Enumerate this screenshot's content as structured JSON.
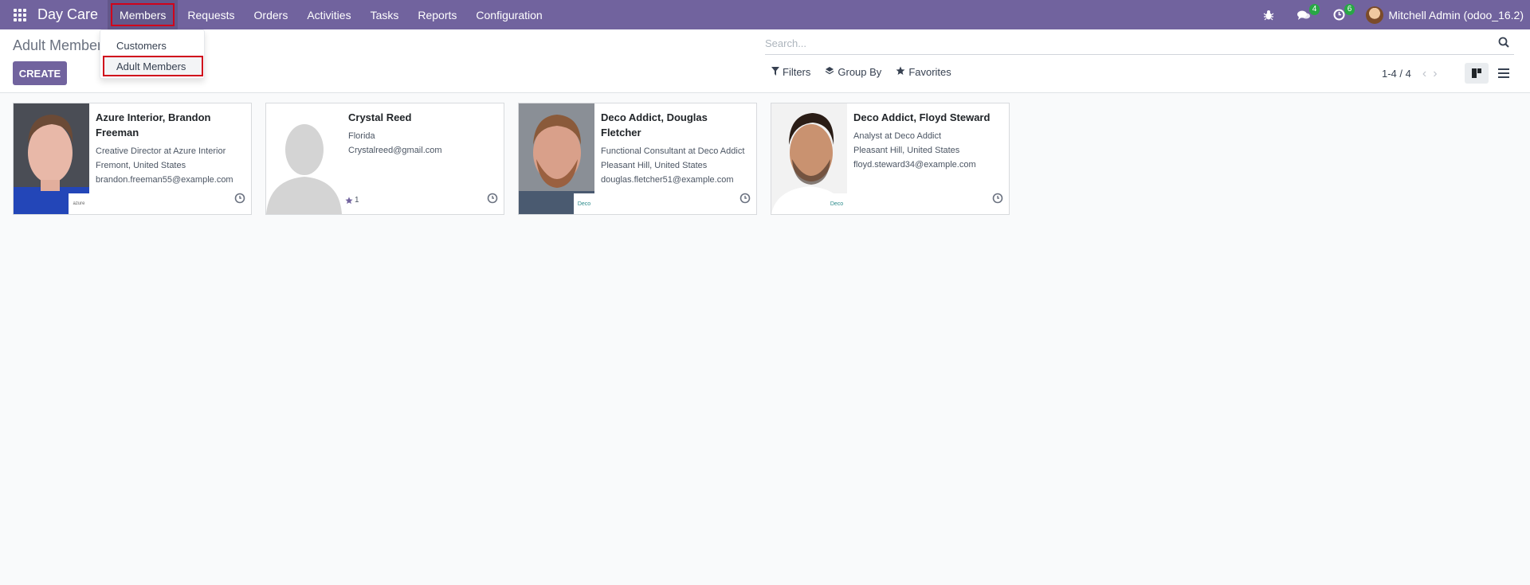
{
  "navbar": {
    "brand": "Day Care",
    "menu": [
      "Members",
      "Requests",
      "Orders",
      "Activities",
      "Tasks",
      "Reports",
      "Configuration"
    ],
    "messages_count": "4",
    "activities_count": "6",
    "user": "Mitchell Admin (odoo_16.2)",
    "bg_color": "#71639e"
  },
  "dropdown": {
    "items": [
      "Customers",
      "Adult Members"
    ]
  },
  "control_panel": {
    "title": "Adult Members",
    "create_label": "CREATE",
    "search_placeholder": "Search...",
    "filters_label": "Filters",
    "groupby_label": "Group By",
    "favorites_label": "Favorites",
    "pager": "1-4 / 4"
  },
  "cards": [
    {
      "name": "Azure Interior, Brandon Freeman",
      "lines": [
        "Creative Director at Azure Interior",
        "Fremont, United States",
        "brandon.freeman55@example.com"
      ],
      "logo": "azure"
    },
    {
      "name": "Crystal Reed",
      "lines": [
        "Florida",
        "Crystalreed@gmail.com"
      ],
      "stars": "1"
    },
    {
      "name": "Deco Addict, Douglas Fletcher",
      "lines": [
        "Functional Consultant at Deco Addict",
        "Pleasant Hill, United States",
        "douglas.fletcher51@example.com"
      ],
      "logo": "Deco"
    },
    {
      "name": "Deco Addict, Floyd Steward",
      "lines": [
        "Analyst at Deco Addict",
        "Pleasant Hill, United States",
        "floyd.steward34@example.com"
      ],
      "logo": "Deco"
    }
  ]
}
